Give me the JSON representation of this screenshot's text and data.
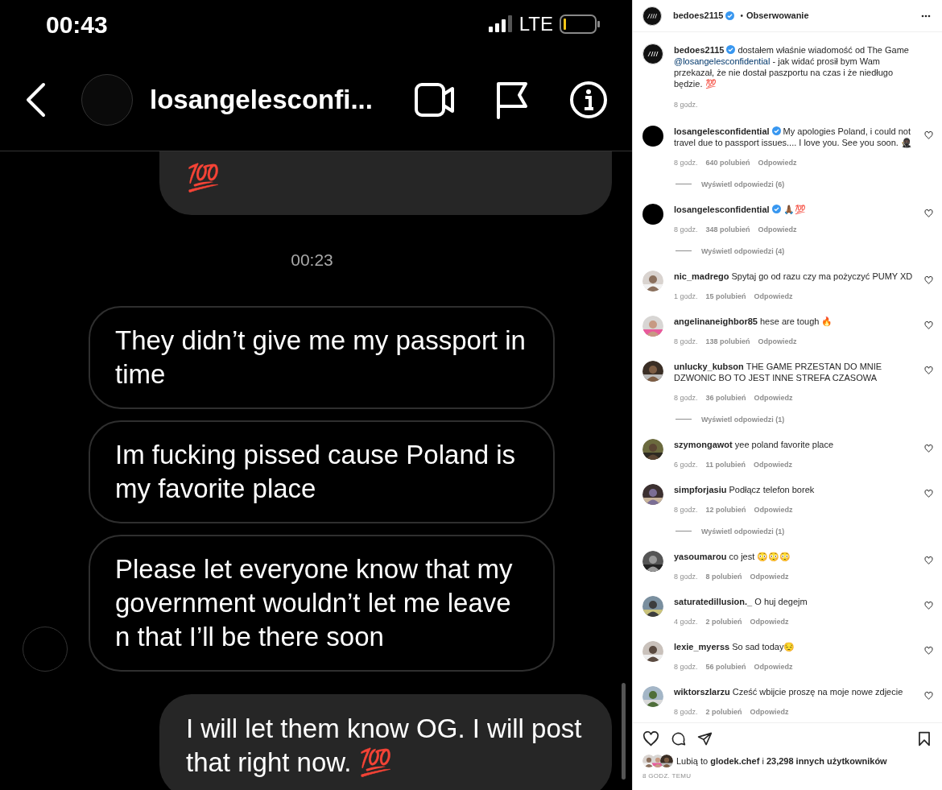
{
  "status_bar": {
    "time": "00:43",
    "network": "LTE"
  },
  "chat_header": {
    "title": "losangelesconfi..."
  },
  "messages": [
    {
      "kind": "sent",
      "text": "💯",
      "cut_top": true
    },
    {
      "kind": "time",
      "text": "00:23"
    },
    {
      "kind": "received",
      "text": "They didn’t give me my passport in time",
      "avatar": false
    },
    {
      "kind": "received",
      "text": "Im fucking pissed cause Poland is my favorite place",
      "avatar": false
    },
    {
      "kind": "received",
      "text": "Please let everyone know that my government wouldn’t let me leave n that I’ll be there soon",
      "avatar": true
    },
    {
      "kind": "sent",
      "text": "I will let them know OG. I will post that right now. 💯",
      "cut_top": false
    }
  ],
  "post_header": {
    "user": "bedoes2115",
    "verified": true,
    "separator": "•",
    "follow": "Obserwowanie"
  },
  "caption": {
    "user": "bedoes2115",
    "verified": true,
    "text_before": "dostałem właśnie wiadomość od The Game",
    "mention": "@losangelesconfidential",
    "text_after": "- jak widać prosił bym Wam przekazał, że nie dostał paszportu na czas i że niedługo będzie. 💯",
    "time": "8 godz."
  },
  "comments": [
    {
      "user": "losangelesconfidential",
      "verified": true,
      "kind": "plain",
      "text": "My apologies Poland, i could not travel due to passport issues.... I love you. See you soon. 🥷🏿",
      "time": "8 godz.",
      "likes": "640 polubień",
      "reply": "Odpowiedz",
      "replies": "Wyświetl odpowiedzi (6)"
    },
    {
      "user": "losangelesconfidential",
      "verified": true,
      "kind": "plain",
      "text": "🙏🏾💯",
      "time": "8 godz.",
      "likes": "348 polubień",
      "reply": "Odpowiedz",
      "replies": "Wyświetl odpowiedzi (4)"
    },
    {
      "user": "nic_madrego",
      "verified": false,
      "text": "Spytaj go od razu czy ma pożyczyć PUMY XD",
      "time": "1 godz.",
      "likes": "15 polubień",
      "reply": "Odpowiedz"
    },
    {
      "user": "angelinaneighbor85",
      "verified": false,
      "text": "hese are tough 🔥",
      "time": "8 godz.",
      "likes": "138 polubień",
      "reply": "Odpowiedz"
    },
    {
      "user": "unlucky_kubson",
      "verified": false,
      "text": "THE GAME PRZESTAN DO MNIE DZWONIC BO TO JEST INNE STREFA CZASOWA",
      "time": "8 godz.",
      "likes": "36 polubień",
      "reply": "Odpowiedz",
      "replies": "Wyświetl odpowiedzi (1)"
    },
    {
      "user": "szymongawot",
      "verified": false,
      "text": "yee poland favorite place",
      "time": "6 godz.",
      "likes": "11 polubień",
      "reply": "Odpowiedz"
    },
    {
      "user": "simpforjasiu",
      "verified": false,
      "text": "Podłącz telefon borek",
      "time": "8 godz.",
      "likes": "12 polubień",
      "reply": "Odpowiedz",
      "replies": "Wyświetl odpowiedzi (1)"
    },
    {
      "user": "yasoumarou",
      "verified": false,
      "text": "co jest 😳😳😳",
      "time": "8 godz.",
      "likes": "8 polubień",
      "reply": "Odpowiedz"
    },
    {
      "user": "saturatedillusion._",
      "verified": false,
      "text": "O huj degejm",
      "time": "4 godz.",
      "likes": "2 polubień",
      "reply": "Odpowiedz"
    },
    {
      "user": "lexie_myerss",
      "verified": false,
      "text": "So sad today😔",
      "time": "8 godz.",
      "likes": "56 polubień",
      "reply": "Odpowiedz"
    },
    {
      "user": "wiktorszlarzu",
      "verified": false,
      "text": "Cześć wbijcie proszę na moje nowe zdjecie",
      "time": "8 godz.",
      "likes": "2 polubień",
      "reply": "Odpowiedz"
    }
  ],
  "likes_line": "Lubią to **glodek.chef** i **23,298 innych użytkowników**",
  "post_time": "8 GODZ. TEMU"
}
